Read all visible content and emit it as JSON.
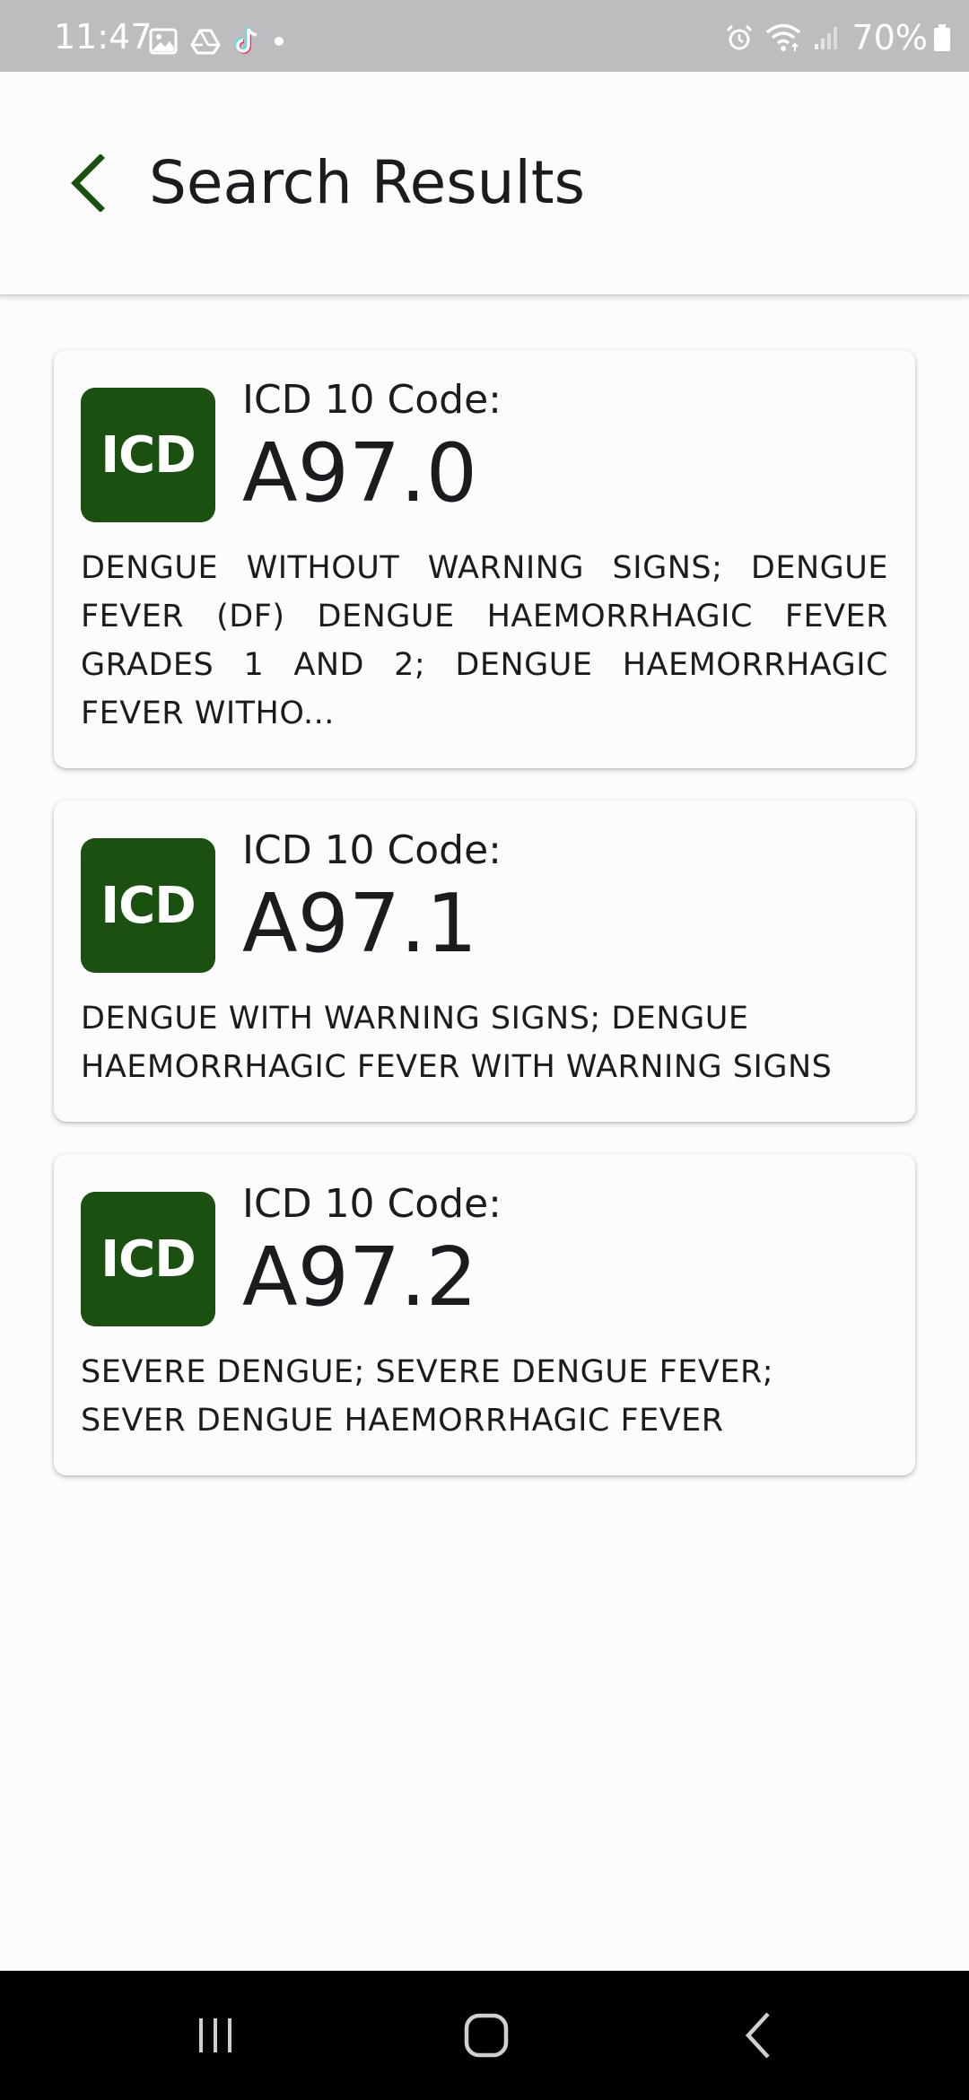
{
  "status_bar": {
    "time": "11:47",
    "battery_percent": "70%",
    "left_icons": [
      "gallery-icon",
      "drive-icon",
      "tiktok-icon",
      "dot-icon"
    ],
    "right_icons": [
      "alarm-icon",
      "wifi-icon",
      "signal-icon",
      "battery-icon"
    ]
  },
  "app_bar": {
    "title": "Search Results",
    "back_icon": "chevron-left-icon"
  },
  "colors": {
    "accent": "#1b5110",
    "status_bar": "#bdbdbf",
    "background": "#fdfcfd",
    "nav_bar": "#000000"
  },
  "results": [
    {
      "badge": "ICD",
      "label": "ICD 10 Code:",
      "code": "A97.0",
      "description": "DENGUE WITHOUT WARNING SIGNS; DENGUE FEVER (DF) DENGUE HAEMORRHAGIC FEVER GRADES 1 AND 2; DENGUE HAEMORRHAGIC FEVER WITHO..."
    },
    {
      "badge": "ICD",
      "label": "ICD 10 Code:",
      "code": "A97.1",
      "description": "DENGUE WITH WARNING SIGNS; DENGUE HAEMORRHAGIC FEVER WITH WARNING SIGNS"
    },
    {
      "badge": "ICD",
      "label": "ICD 10 Code:",
      "code": "A97.2",
      "description": "SEVERE DENGUE; SEVERE DENGUE FEVER; SEVER DENGUE HAEMORRHAGIC FEVER"
    }
  ],
  "nav_bar": {
    "icons": [
      "recents-icon",
      "home-icon",
      "back-icon"
    ]
  }
}
